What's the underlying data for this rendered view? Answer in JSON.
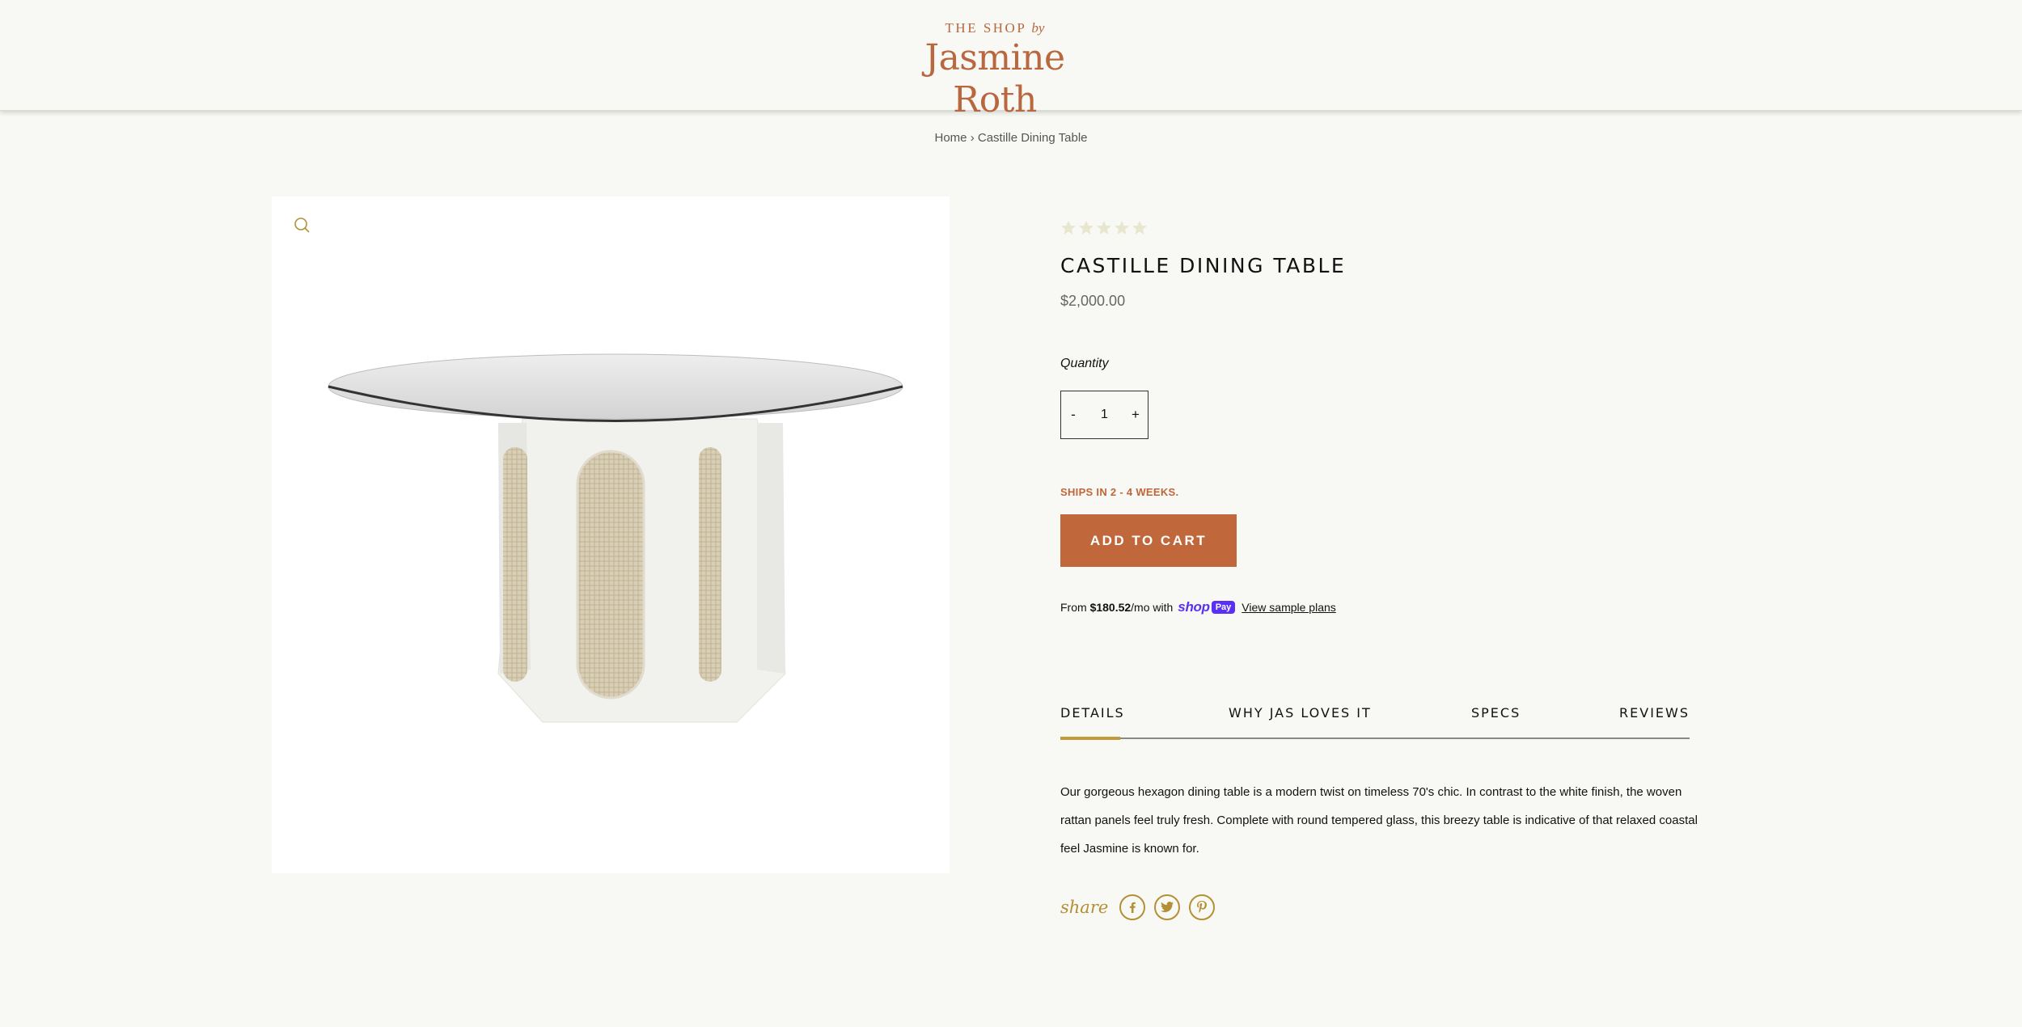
{
  "header": {
    "logo_top": "THE SHOP",
    "logo_by": "by",
    "logo_main": "Jasmine Roth"
  },
  "breadcrumb": {
    "home": "Home",
    "separator": "›",
    "current": "Castille Dining Table"
  },
  "product": {
    "title": "CASTILLE DINING TABLE",
    "price": "$2,000.00",
    "rating": 0,
    "rating_max": 5,
    "quantity_label": "Quantity",
    "quantity_value": "1",
    "qty_minus": "-",
    "qty_plus": "+",
    "ships_note": "SHIPS IN 2 - 4 WEEKS.",
    "add_to_cart": "ADD TO CART",
    "image_alt": "Castille Dining Table"
  },
  "shoppay": {
    "from_text": "From",
    "amount": "$180.52",
    "per_text": "/mo with",
    "shop_word": "shop",
    "pay_word": "Pay",
    "link": "View sample plans"
  },
  "tabs": [
    {
      "label": "DETAILS",
      "active": true
    },
    {
      "label": "WHY JAS LOVES IT",
      "active": false
    },
    {
      "label": "SPECS",
      "active": false
    },
    {
      "label": "REVIEWS",
      "active": false
    }
  ],
  "details_text": "Our gorgeous hexagon dining table is a modern twist on timeless 70's chic. In contrast to the white finish, the woven rattan panels feel truly fresh. Complete with round tempered glass, this breezy table is indicative of that relaxed coastal feel Jasmine is known for.",
  "share": {
    "label": "share",
    "icons": [
      "facebook-icon",
      "twitter-icon",
      "pinterest-icon"
    ]
  },
  "colors": {
    "background": "#f8f9f4",
    "brand": "#b8673f",
    "button": "#c0683c",
    "gold": "#b39035",
    "shoppay": "#5a31f4"
  }
}
